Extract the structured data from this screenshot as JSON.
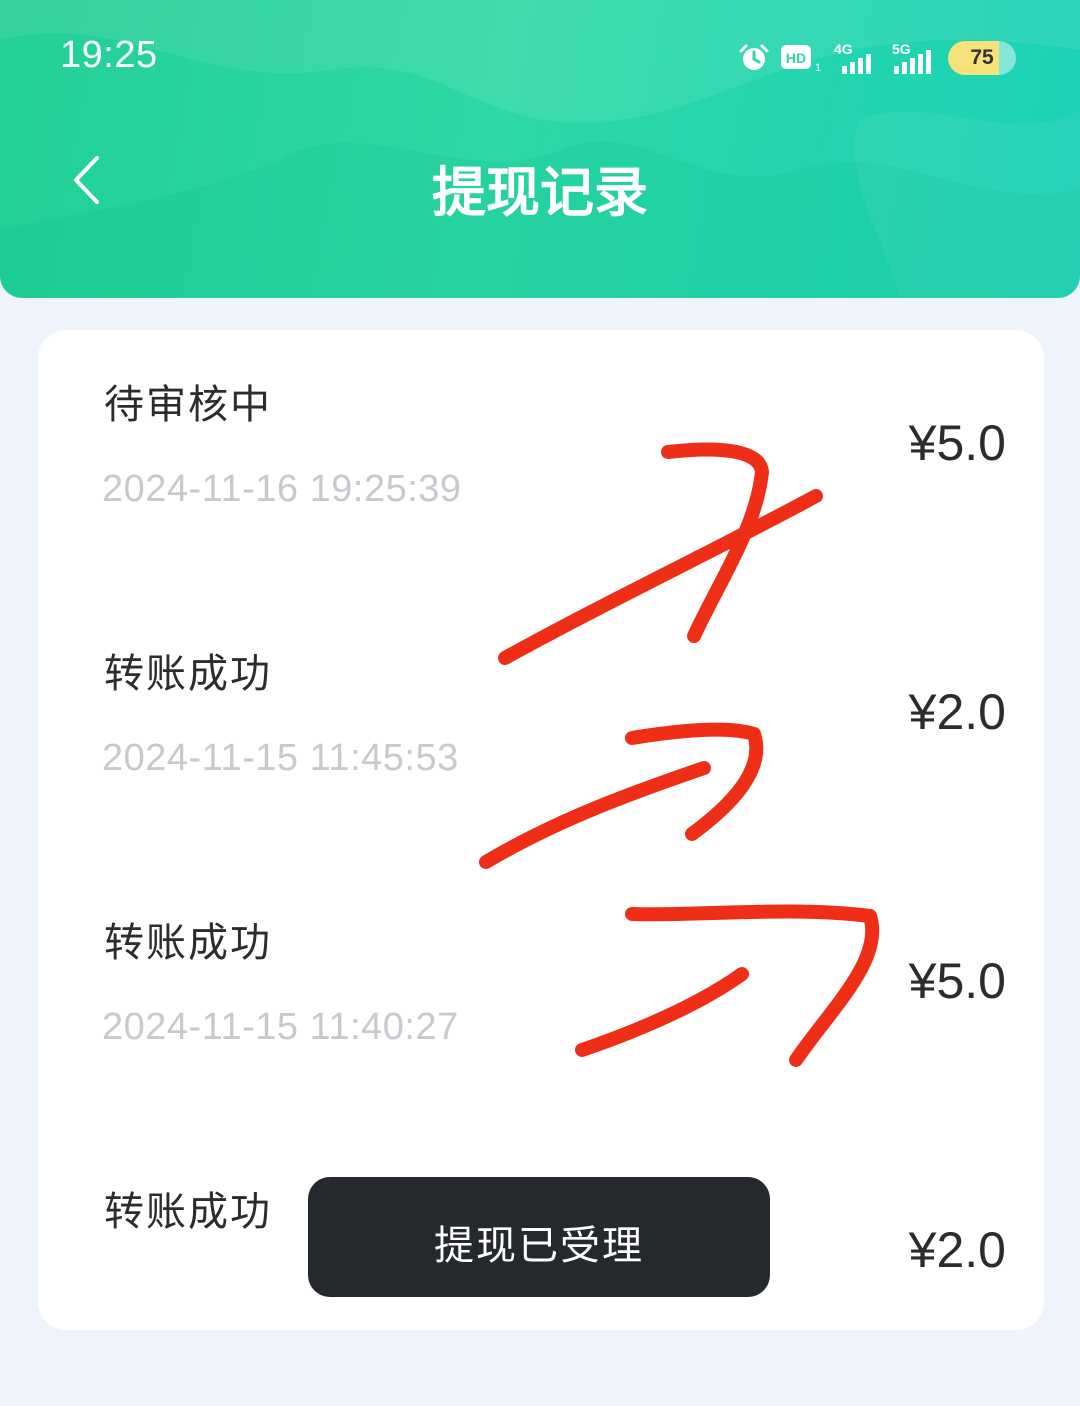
{
  "status_bar": {
    "time": "19:25",
    "battery": "75",
    "battery_level_percent": 75,
    "icons": [
      "alarm-icon",
      "hd-icon",
      "4g-signal-icon",
      "5g-signal-icon",
      "battery-icon"
    ],
    "net_4g": "4G",
    "net_5g": "5G",
    "hd": "HD"
  },
  "header": {
    "title": "提现记录",
    "back_icon": "chevron-left-icon",
    "background_color": "#2ed8a6"
  },
  "records": [
    {
      "status": "待审核中",
      "time": "2024-11-16 19:25:39",
      "amount": "¥5.0"
    },
    {
      "status": "转账成功",
      "time": "2024-11-15 11:45:53",
      "amount": "¥2.0"
    },
    {
      "status": "转账成功",
      "time": "2024-11-15 11:40:27",
      "amount": "¥5.0"
    },
    {
      "status": "转账成功",
      "time": "",
      "amount": "¥2.0"
    }
  ],
  "toast": {
    "message": "提现已受理"
  },
  "annotation_color": "#ef2e17"
}
